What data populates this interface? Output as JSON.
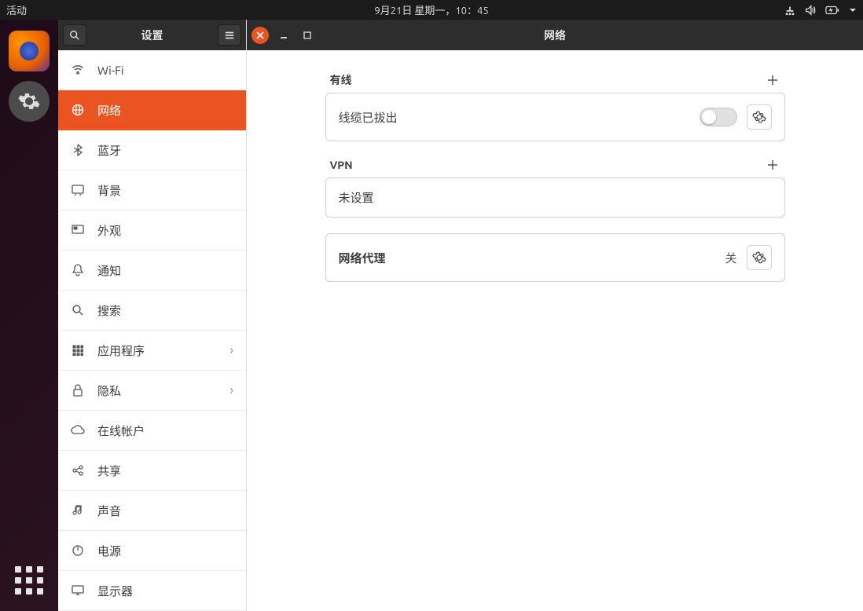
{
  "topbar": {
    "activities": "活动",
    "clock": "9月21日 星期一，10：45"
  },
  "settings_title": "设置",
  "content_title": "网络",
  "sidebar": {
    "items": [
      {
        "label": "Wi-Fi"
      },
      {
        "label": "网络"
      },
      {
        "label": "蓝牙"
      },
      {
        "label": "背景"
      },
      {
        "label": "外观"
      },
      {
        "label": "通知"
      },
      {
        "label": "搜索"
      },
      {
        "label": "应用程序",
        "chev": true
      },
      {
        "label": "隐私",
        "chev": true
      },
      {
        "label": "在线帐户"
      },
      {
        "label": "共享"
      },
      {
        "label": "声音"
      },
      {
        "label": "电源"
      },
      {
        "label": "显示器"
      }
    ]
  },
  "network": {
    "wired_heading": "有线",
    "wired_status": "线缆已拔出",
    "vpn_heading": "VPN",
    "vpn_status": "未设置",
    "proxy_heading": "网络代理",
    "proxy_status": "关"
  }
}
